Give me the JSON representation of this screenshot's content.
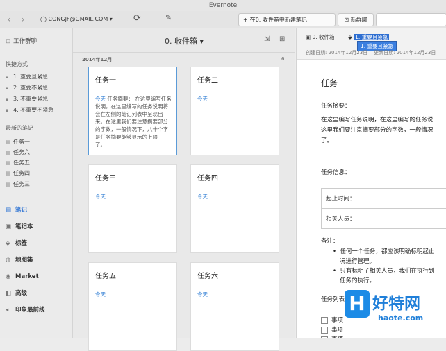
{
  "window": {
    "title": "Evernote"
  },
  "toolbar": {
    "account": "CONGJF@GMAIL.COM",
    "new_note_label": "在0. 收件箱中新建笔记",
    "new_chat_label": "新群聊"
  },
  "sidebar": {
    "work_chat": "工作群聊",
    "shortcuts_heading": "快捷方式",
    "shortcuts": [
      "1. 重要且紧急",
      "2. 重要不紧急",
      "3. 不重要紧急",
      "4. 不重要不紧急"
    ],
    "recent_heading": "最新的笔记",
    "recent": [
      "任务一",
      "任务六",
      "任务五",
      "任务四",
      "任务三"
    ],
    "main": [
      "笔记",
      "笔记本",
      "标签",
      "地图集",
      "Market",
      "高级",
      "印象最前线"
    ]
  },
  "notelist": {
    "title": "0. 收件箱",
    "group_date": "2014年12月",
    "group_count": "6",
    "cards": [
      {
        "title": "任务一",
        "date": "今天",
        "snippet": "任务摘要： 在这里编写任务说明，在这里编写的任务说明将会在左侧的笔记列表中呈现出来。在这里我们要注意摘要部分的字数，一般情况下，八十个字是任务摘要能够显示的上限了。…"
      },
      {
        "title": "任务二",
        "date": "今天",
        "snippet": ""
      },
      {
        "title": "任务三",
        "date": "今天",
        "snippet": ""
      },
      {
        "title": "任务四",
        "date": "今天",
        "snippet": ""
      },
      {
        "title": "任务五",
        "date": "今天",
        "snippet": ""
      },
      {
        "title": "任务六",
        "date": "今天",
        "snippet": ""
      }
    ]
  },
  "detail": {
    "notebook": "0. 收件箱",
    "tag": "1. 重要且紧急",
    "tag_suggestion": "1. 重要且紧急",
    "created": "创建日期: 2014年12月23日",
    "updated": "更新日期: 2014年12月23日",
    "title": "任务一",
    "summary_label": "任务摘要：",
    "summary_line1": "在这里编写任务说明，在这里编写的任务说",
    "summary_line2": "这里我们要注意摘要部分的字数，一般情况",
    "summary_line3": "了。",
    "info_label": "任务信息：",
    "row1": "起止时间：",
    "row2": "相关人员：",
    "notes_label": "备注：",
    "note1a": "任何一个任务，都应该明确标明起止",
    "note1b": "况进行管理。",
    "note2a": "只有标明了相关人员，我们在执行到",
    "note2b": "任务的执行。",
    "list_label": "任务列表：",
    "items": [
      "事项",
      "事项",
      "事项"
    ]
  },
  "watermark": {
    "logo": "H",
    "text": "好特网",
    "url": "haote.com"
  }
}
